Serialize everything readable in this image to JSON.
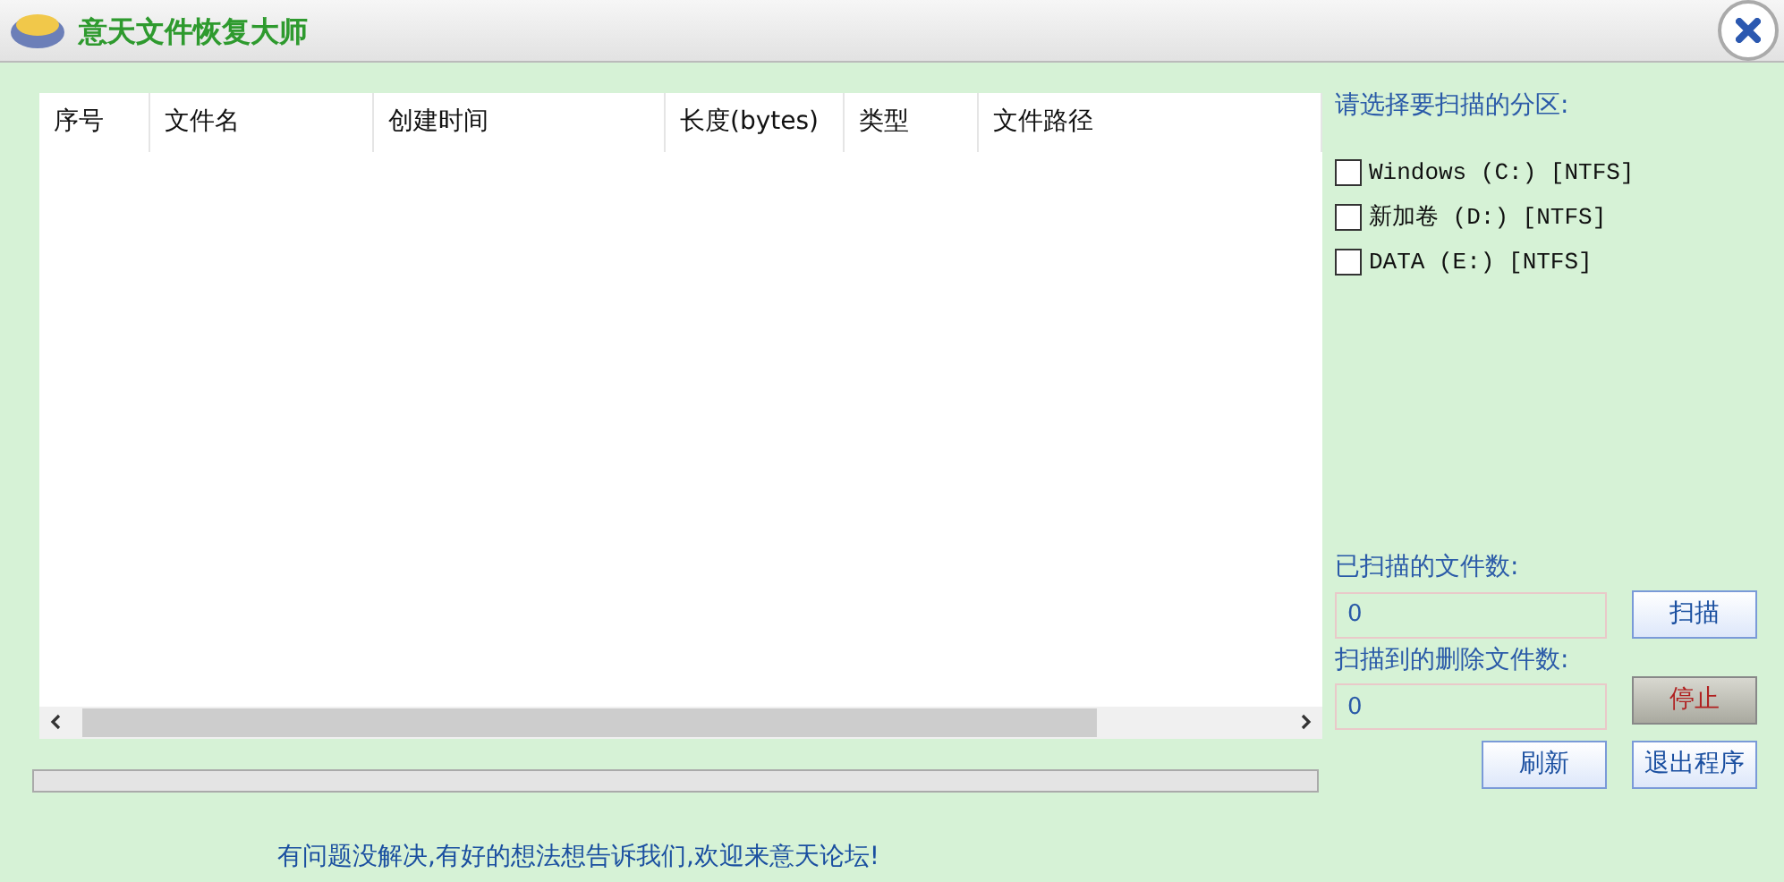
{
  "window": {
    "title": "意天文件恢复大师"
  },
  "table": {
    "columns": [
      "序号",
      "文件名",
      "创建时间",
      "长度(bytes)",
      "类型",
      "文件路径"
    ]
  },
  "progress": {
    "level": 0
  },
  "footer_link": "有问题没解决,有好的想法想告诉我们,欢迎来意天论坛!",
  "partitions": {
    "label": "请选择要扫描的分区:",
    "items": [
      {
        "label": "Windows (C:) [NTFS]",
        "checked": false
      },
      {
        "label": "新加卷 (D:) [NTFS]",
        "checked": false
      },
      {
        "label": "DATA (E:) [NTFS]",
        "checked": false
      }
    ]
  },
  "scanned_files": {
    "label": "已扫描的文件数:",
    "value": "0"
  },
  "deleted_files": {
    "label": "扫描到的删除文件数:",
    "value": "0"
  },
  "buttons": [
    {
      "label": "扫描",
      "kind": "normal"
    },
    {
      "label": "停止",
      "kind": "stop"
    },
    {
      "label": "刷新",
      "kind": "normal"
    },
    {
      "label": "退出程序",
      "kind": "normal"
    }
  ]
}
